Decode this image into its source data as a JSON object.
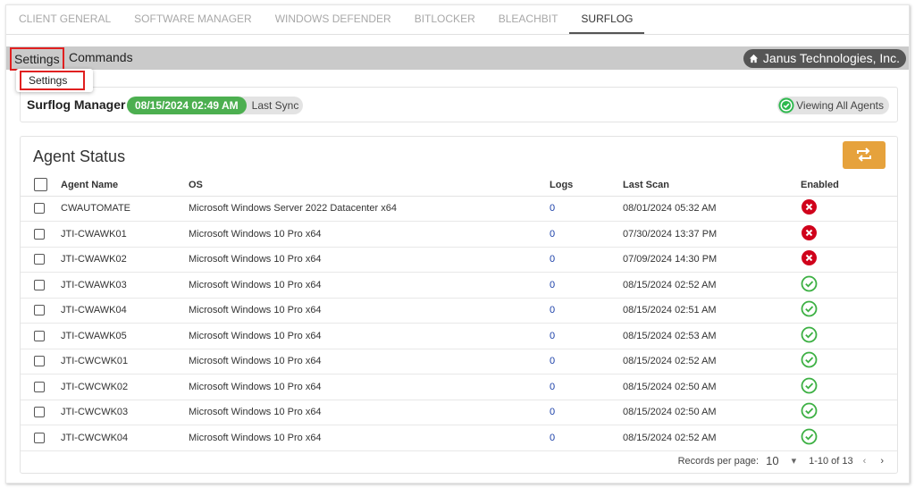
{
  "tabs": [
    "CLIENT GENERAL",
    "SOFTWARE MANAGER",
    "WINDOWS DEFENDER",
    "BITLOCKER",
    "BLEACHBIT",
    "SURFLOG"
  ],
  "menu": {
    "settings": "Settings",
    "commands": "Commands",
    "dropdown_item": "Settings"
  },
  "company": "Janus Technologies, Inc.",
  "manager": {
    "title": "Surflog Manager",
    "sync_date": "08/15/2024 02:49 AM",
    "sync_label": "Last Sync",
    "viewing": "Viewing All Agents"
  },
  "agent_status": {
    "title": "Agent Status",
    "columns": [
      "Agent Name",
      "OS",
      "Logs",
      "Last Scan",
      "Enabled"
    ],
    "rows": [
      {
        "name": "CWAUTOMATE",
        "os": "Microsoft Windows Server 2022 Datacenter x64",
        "logs": "0",
        "scan": "08/01/2024 05:32 AM",
        "enabled": false
      },
      {
        "name": "JTI-CWAWK01",
        "os": "Microsoft Windows 10 Pro x64",
        "logs": "0",
        "scan": "07/30/2024 13:37 PM",
        "enabled": false
      },
      {
        "name": "JTI-CWAWK02",
        "os": "Microsoft Windows 10 Pro x64",
        "logs": "0",
        "scan": "07/09/2024 14:30 PM",
        "enabled": false
      },
      {
        "name": "JTI-CWAWK03",
        "os": "Microsoft Windows 10 Pro x64",
        "logs": "0",
        "scan": "08/15/2024 02:52 AM",
        "enabled": true
      },
      {
        "name": "JTI-CWAWK04",
        "os": "Microsoft Windows 10 Pro x64",
        "logs": "0",
        "scan": "08/15/2024 02:51 AM",
        "enabled": true
      },
      {
        "name": "JTI-CWAWK05",
        "os": "Microsoft Windows 10 Pro x64",
        "logs": "0",
        "scan": "08/15/2024 02:53 AM",
        "enabled": true
      },
      {
        "name": "JTI-CWCWK01",
        "os": "Microsoft Windows 10 Pro x64",
        "logs": "0",
        "scan": "08/15/2024 02:52 AM",
        "enabled": true
      },
      {
        "name": "JTI-CWCWK02",
        "os": "Microsoft Windows 10 Pro x64",
        "logs": "0",
        "scan": "08/15/2024 02:50 AM",
        "enabled": true
      },
      {
        "name": "JTI-CWCWK03",
        "os": "Microsoft Windows 10 Pro x64",
        "logs": "0",
        "scan": "08/15/2024 02:50 AM",
        "enabled": true
      },
      {
        "name": "JTI-CWCWK04",
        "os": "Microsoft Windows 10 Pro x64",
        "logs": "0",
        "scan": "08/15/2024 02:52 AM",
        "enabled": true
      }
    ]
  },
  "pager": {
    "label": "Records per page:",
    "per_page": "10",
    "range": "1-10 of 13"
  },
  "colors": {
    "green": "#4caf50",
    "red": "#d0021b",
    "orange": "#e6a23c",
    "check": "#3cb043"
  }
}
